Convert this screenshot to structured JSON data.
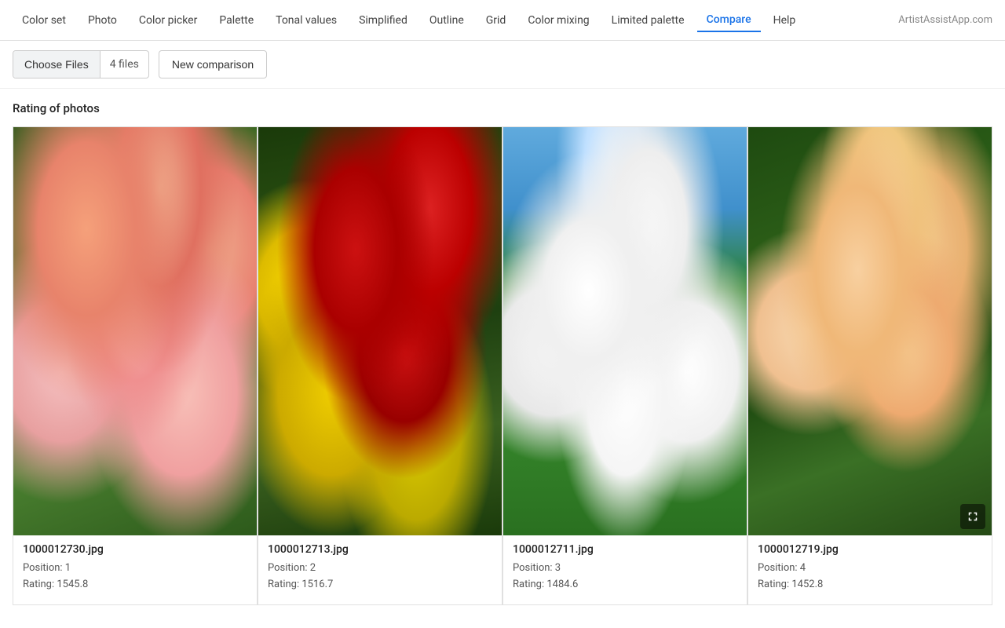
{
  "nav": {
    "items": [
      {
        "id": "color-set",
        "label": "Color set",
        "active": false
      },
      {
        "id": "photo",
        "label": "Photo",
        "active": false
      },
      {
        "id": "color-picker",
        "label": "Color picker",
        "active": false
      },
      {
        "id": "palette",
        "label": "Palette",
        "active": false
      },
      {
        "id": "tonal-values",
        "label": "Tonal values",
        "active": false
      },
      {
        "id": "simplified",
        "label": "Simplified",
        "active": false
      },
      {
        "id": "outline",
        "label": "Outline",
        "active": false
      },
      {
        "id": "grid",
        "label": "Grid",
        "active": false
      },
      {
        "id": "color-mixing",
        "label": "Color mixing",
        "active": false
      },
      {
        "id": "limited-palette",
        "label": "Limited palette",
        "active": false
      },
      {
        "id": "compare",
        "label": "Compare",
        "active": true
      },
      {
        "id": "help",
        "label": "Help",
        "active": false
      }
    ],
    "logo": "ArtistAssistApp.com"
  },
  "toolbar": {
    "choose_files_label": "Choose Files",
    "file_count": "4 files",
    "new_comparison_label": "New comparison"
  },
  "main": {
    "section_title": "Rating of photos",
    "photos": [
      {
        "filename": "1000012730.jpg",
        "position": "Position: 1",
        "rating": "Rating: 1545.8",
        "flower_class": "flower-1"
      },
      {
        "filename": "1000012713.jpg",
        "position": "Position: 2",
        "rating": "Rating: 1516.7",
        "flower_class": "flower-2"
      },
      {
        "filename": "1000012711.jpg",
        "position": "Position: 3",
        "rating": "Rating: 1484.6",
        "flower_class": "flower-3"
      },
      {
        "filename": "1000012719.jpg",
        "position": "Position: 4",
        "rating": "Rating: 1452.8",
        "flower_class": "flower-4"
      }
    ]
  }
}
